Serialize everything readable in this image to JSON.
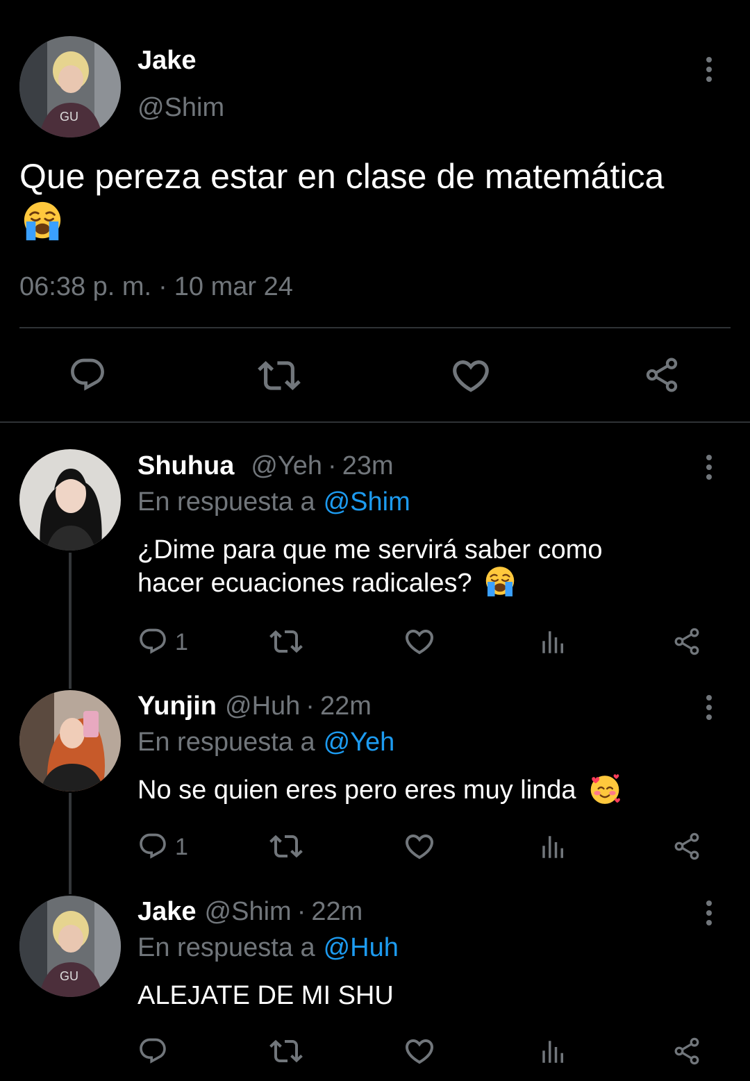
{
  "main_tweet": {
    "display_name": "Jake",
    "handle": "@Shim",
    "text": "Que pereza estar en clase de matemática",
    "emoji": "loudly-crying-face",
    "timestamp": "06:38 p. m.",
    "separator": "·",
    "date": "10 mar 24"
  },
  "replies": [
    {
      "display_name": "Shuhua",
      "handle": "@Yeh",
      "dot": "·",
      "time": "23m",
      "reply_prefix": "En respuesta a",
      "reply_to": "@Shim",
      "text_line1": "¿Dime para que me servirá saber como",
      "text_line2": "hacer ecuaciones radicales?",
      "emoji": "loudly-crying-face",
      "reply_count": "1"
    },
    {
      "display_name": "Yunjin",
      "handle": "@Huh",
      "dot": "·",
      "time": "22m",
      "reply_prefix": "En respuesta a",
      "reply_to": "@Yeh",
      "text_line1": "No se quien eres pero eres muy linda",
      "emoji": "smiling-face-with-hearts",
      "reply_count": "1"
    },
    {
      "display_name": "Jake",
      "handle": "@Shim",
      "dot": "·",
      "time": "22m",
      "reply_prefix": "En respuesta a",
      "reply_to": "@Huh",
      "text_line1": "ALEJATE DE MI SHU"
    }
  ],
  "colors": {
    "background": "#000000",
    "text": "#e7e9ea",
    "muted": "#71767b",
    "link": "#1d9bf0",
    "divider": "#2f3336"
  }
}
